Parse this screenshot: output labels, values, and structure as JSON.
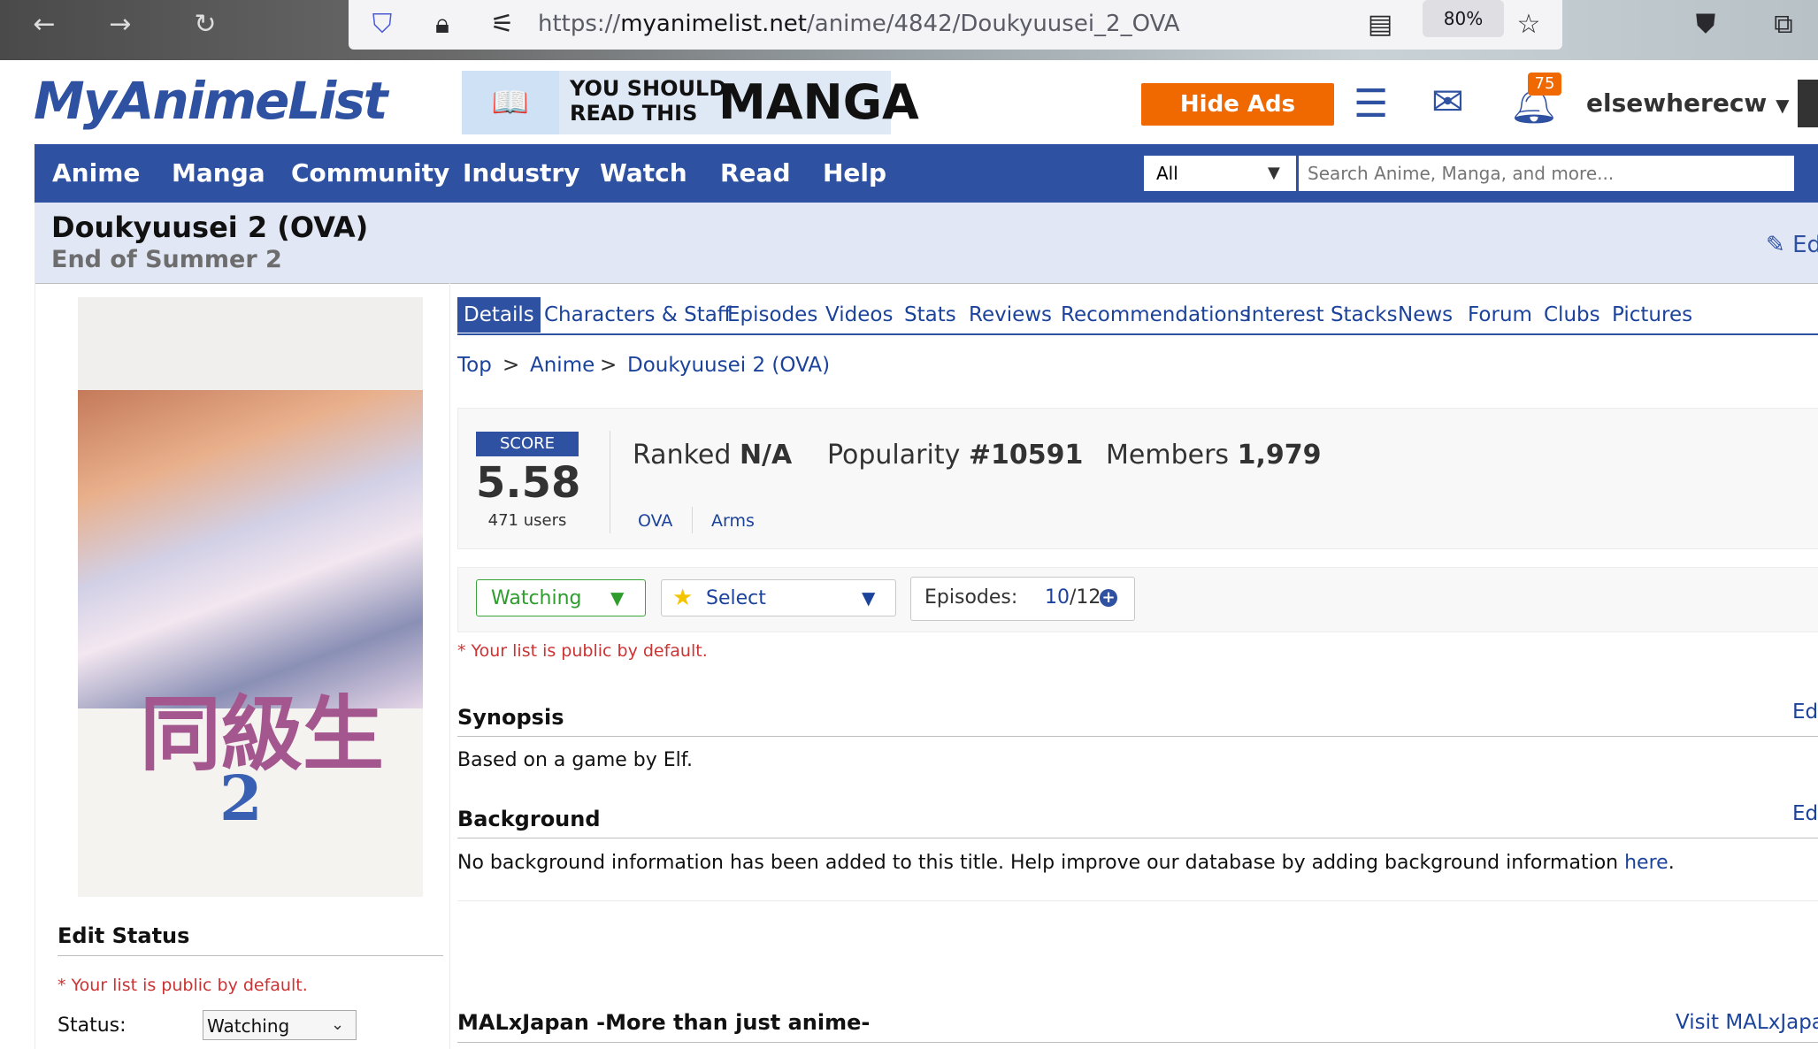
{
  "browser": {
    "url_prefix": "https://",
    "url_domain": "myanimelist.net",
    "url_path": "/anime/4842/Doukyuusei_2_OVA",
    "zoom": "80%"
  },
  "header": {
    "logo": "MyAnimeList",
    "banner_line1": "YOU SHOULD",
    "banner_line2": "READ THIS",
    "banner_big": "MANGA",
    "hide_ads": "Hide Ads",
    "notification_count": "75",
    "username": "elsewherecw"
  },
  "nav": {
    "items": [
      "Anime",
      "Manga",
      "Community",
      "Industry",
      "Watch",
      "Read",
      "Help"
    ],
    "search_category": "All",
    "search_placeholder": "Search Anime, Manga, and more..."
  },
  "title": {
    "main": "Doukyuusei 2 (OVA)",
    "english": "End of Summer 2",
    "edit": "Edit"
  },
  "cover": {
    "kanji": "同級生",
    "number": "2"
  },
  "tabs": [
    "Details",
    "Characters & Staff",
    "Episodes",
    "Videos",
    "Stats",
    "Reviews",
    "Recommendations",
    "Interest Stacks",
    "News",
    "Forum",
    "Clubs",
    "Pictures"
  ],
  "breadcrumb": [
    "Top",
    "Anime",
    "Doukyuusei 2 (OVA)"
  ],
  "breadcrumb_sep": ">",
  "stats": {
    "score_label": "SCORE",
    "score": "5.58",
    "score_users": "471 users",
    "ranked_label": "Ranked",
    "ranked_value": "N/A",
    "popularity_label": "Popularity",
    "popularity_value": "#10591",
    "members_label": "Members",
    "members_value": "1,979",
    "type": "OVA",
    "studio": "Arms"
  },
  "list_status": {
    "status": "Watching",
    "score_select": "Select",
    "episodes_label": "Episodes:",
    "episodes_watched": "10",
    "episodes_total": "/12",
    "note": "* Your list is public by default."
  },
  "synopsis": {
    "heading": "Synopsis",
    "edit": "Edit",
    "text": "Based on a game by Elf."
  },
  "background": {
    "heading": "Background",
    "edit": "Edit",
    "text": "No background information has been added to this title. Help improve our database by adding background information ",
    "link": "here",
    "end": "."
  },
  "malxjapan": {
    "heading": "MALxJapan -More than just anime-",
    "link": "Visit MALxJapan"
  },
  "sidebar": {
    "edit_status_heading": "Edit Status",
    "note": "* Your list is public by default.",
    "status_label": "Status:",
    "status_value": "Watching"
  },
  "colors": {
    "brand_blue": "#2e51a2",
    "hide_ads_orange": "#f06800",
    "watching_green": "#2e9d2e",
    "note_red": "#cc3333"
  }
}
